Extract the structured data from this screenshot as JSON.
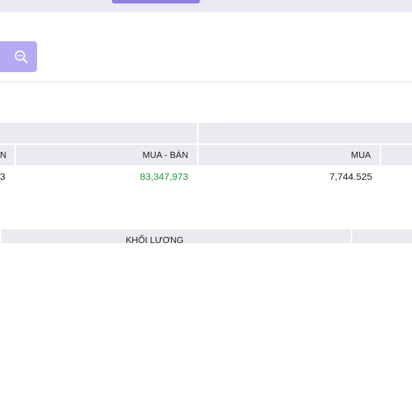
{
  "search": {
    "icon": "zoom-search-icon",
    "button_color": "#b5a9f4"
  },
  "tabs": {
    "active_indicator_color": "#8e7fe3"
  },
  "summary_table": {
    "headers": {
      "col0": "N",
      "col1": "MUA - BÁN",
      "col2": "MUA"
    },
    "row": {
      "col0": "3",
      "col1": "83,347,973",
      "col2": "7,744.525"
    },
    "positive_color": "#1b9a2f"
  },
  "volume_table": {
    "headers": {
      "col0": "KHỐI LƯỢNG"
    }
  }
}
